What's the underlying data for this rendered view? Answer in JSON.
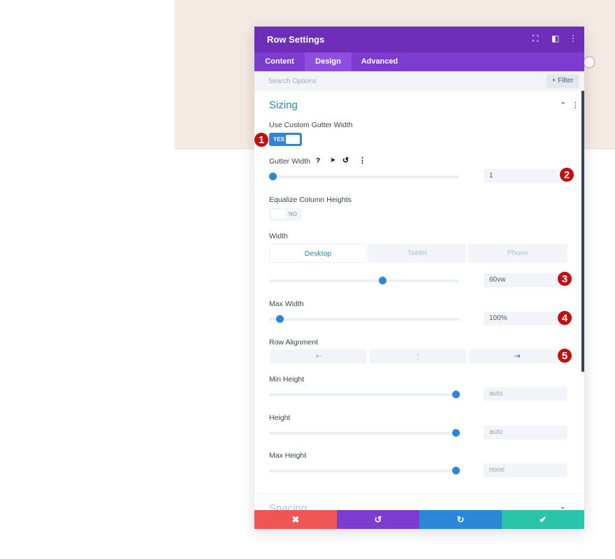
{
  "modal": {
    "title": "Row Settings",
    "header_icons": [
      "fullscreen-icon",
      "split-view-icon",
      "more-options-icon"
    ]
  },
  "tabs": [
    {
      "label": "Content"
    },
    {
      "label": "Design",
      "active": true
    },
    {
      "label": "Advanced"
    }
  ],
  "search": {
    "placeholder": "Search Options",
    "filter_label": "+ Filter"
  },
  "section": {
    "title": "Sizing",
    "next_section": "Spacing"
  },
  "fields": {
    "custom_gutter": {
      "label": "Use Custom Gutter Width",
      "value": "YES"
    },
    "gutter_width": {
      "label": "Gutter Width",
      "value": "1",
      "slider_fraction": 0.02
    },
    "equalize": {
      "label": "Equalize Column Heights",
      "value": "NO"
    },
    "width": {
      "label": "Width",
      "devices": [
        "Desktop",
        "Tablet",
        "Phone"
      ],
      "active_device": "Desktop",
      "value": "60vw",
      "slider_fraction": 0.6
    },
    "max_width": {
      "label": "Max Width",
      "value": "100%",
      "slider_fraction": 0.05
    },
    "row_alignment": {
      "label": "Row Alignment",
      "options": [
        "align-left-icon",
        "align-center-icon",
        "align-right-icon"
      ],
      "selected": "right"
    },
    "min_height": {
      "label": "Min Height",
      "value": "auto",
      "slider_fraction": 0.98
    },
    "height": {
      "label": "Height",
      "value": "auto",
      "slider_fraction": 0.98
    },
    "max_height": {
      "label": "Max Height",
      "value": "none",
      "slider_fraction": 0.98
    }
  },
  "badges": [
    "1",
    "2",
    "3",
    "4",
    "5"
  ],
  "footer": {
    "buttons": [
      "cancel",
      "undo",
      "redo",
      "save"
    ]
  },
  "colors": {
    "header": "#6c2eb9",
    "tabs": "#7e3bd0",
    "accent": "#2b87da",
    "cancel": "#ef5555",
    "undo": "#7e3bd0",
    "redo": "#2b87da",
    "save": "#29c4a9",
    "badge": "#c40d0d"
  }
}
